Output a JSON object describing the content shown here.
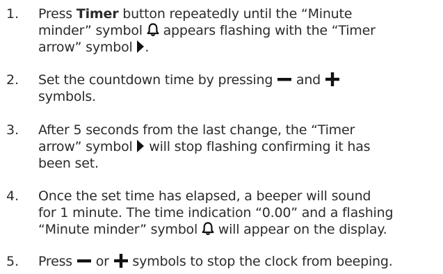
{
  "steps": [
    {
      "number": "1.",
      "line1_a": "Press ",
      "line1_bold": "Timer",
      "line1_b": " button repeatedly until the “Minute",
      "line2_a": "minder” symbol ",
      "line2_b": " appears flashing with the “Timer",
      "line3_a": "arrow” symbol ",
      "line3_b": "."
    },
    {
      "number": "2.",
      "line1_a": "Set the countdown time by pressing ",
      "line1_b": " and ",
      "line2": "symbols."
    },
    {
      "number": "3.",
      "line1": "After 5 seconds from the last change, the “Timer",
      "line2_a": "arrow” symbol ",
      "line2_b": " will stop flashing confirming it has",
      "line3": "been set."
    },
    {
      "number": "4.",
      "line1": "Once the set time has elapsed, a beeper will sound",
      "line2": "for 1 minute. The time indication “0.00” and a flashing",
      "line3_a": "“Minute minder” symbol ",
      "line3_b": " will appear on the display."
    },
    {
      "number": "5.",
      "line1_a": "Press ",
      "line1_b": " or ",
      "line1_c": " symbols to stop the clock from beeping."
    }
  ],
  "icons": {
    "minute_minder": "bell-icon",
    "timer_arrow": "play-arrow-icon",
    "minus": "minus-icon",
    "plus": "plus-icon"
  },
  "colors": {
    "text": "#2b2b2b",
    "symbol": "#111111"
  }
}
